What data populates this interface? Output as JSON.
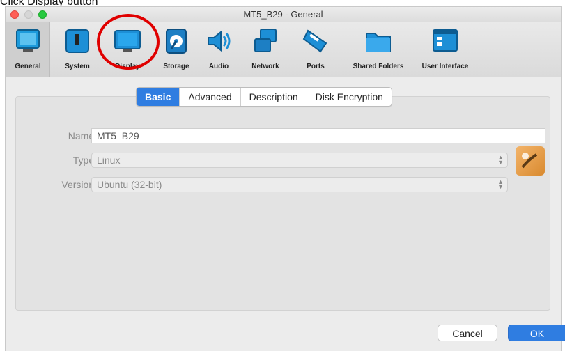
{
  "caption": "Click Display button",
  "window": {
    "title": "MT5_B29 - General"
  },
  "toolbar": {
    "items": [
      {
        "label": "General",
        "icon": "general-icon"
      },
      {
        "label": "System",
        "icon": "system-icon"
      },
      {
        "label": "Display",
        "icon": "display-icon"
      },
      {
        "label": "Storage",
        "icon": "storage-icon"
      },
      {
        "label": "Audio",
        "icon": "audio-icon"
      },
      {
        "label": "Network",
        "icon": "network-icon"
      },
      {
        "label": "Ports",
        "icon": "ports-icon"
      },
      {
        "label": "Shared Folders",
        "icon": "shared-folders-icon"
      },
      {
        "label": "User Interface",
        "icon": "user-interface-icon"
      }
    ],
    "selected": "General",
    "highlighted": "Display",
    "highlight_color": "#e00000"
  },
  "tabs": [
    {
      "label": "Basic",
      "active": true
    },
    {
      "label": "Advanced",
      "active": false
    },
    {
      "label": "Description",
      "active": false
    },
    {
      "label": "Disk Encryption",
      "active": false
    }
  ],
  "form": {
    "name": {
      "label": "Name:",
      "value": "MT5_B29"
    },
    "type": {
      "label": "Type:",
      "value": "Linux"
    },
    "version": {
      "label": "Version:",
      "value": "Ubuntu (32-bit)"
    }
  },
  "buttons": {
    "cancel": "Cancel",
    "ok": "OK"
  },
  "colors": {
    "accent": "#2f7de1",
    "annotation": "#e00000"
  }
}
